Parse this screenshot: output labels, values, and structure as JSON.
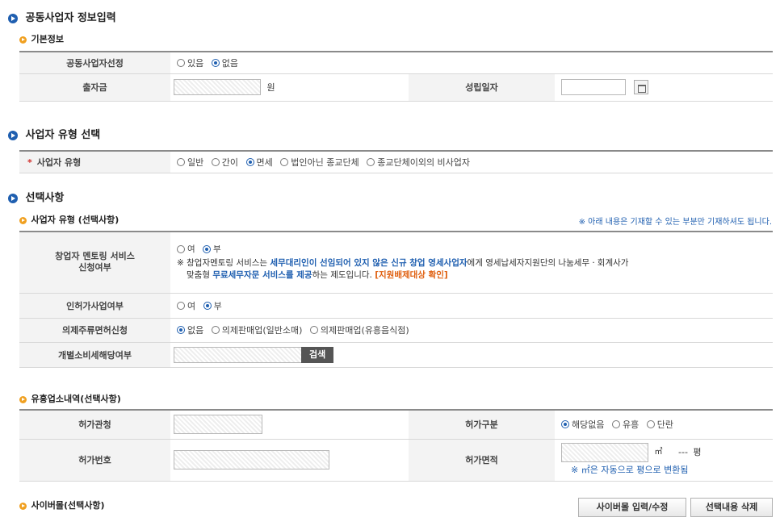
{
  "sections": {
    "joint_title": "공동사업자 정보입력",
    "type_title": "사업자 유형 선택",
    "optional_title": "선택사항"
  },
  "basic": {
    "title": "기본정보",
    "joint_label": "공동사업자선정",
    "joint_options": [
      "있음",
      "없음"
    ],
    "joint_selected": "없음",
    "capital_label": "출자금",
    "capital_unit": "원",
    "founding_label": "성립일자"
  },
  "biz_type": {
    "label": "사업자 유형",
    "required_mark": "*",
    "options": [
      "일반",
      "간이",
      "면세",
      "법인아닌 종교단체",
      "종교단체이외의 비사업자"
    ],
    "selected": "면세"
  },
  "optional": {
    "subtitle": "사업자 유형 (선택사항)",
    "note": "※ 아래 내용은 기재할 수 있는 부분만 기재하셔도 됩니다.",
    "mentoring_label_1": "창업자 멘토링 서비스",
    "mentoring_label_2": "신청여부",
    "yes_no": [
      "여",
      "부"
    ],
    "mentoring_selected": "부",
    "mentoring_desc": {
      "p1": "※ 창업자멘토링 서비스는 ",
      "p2": "세무대리인이 선임되어 있지 않은 신규 창업 영세사업자",
      "p3": "에게 영세납세자지원단의 나눔세무ㆍ회계사가",
      "p4": "맞춤형 ",
      "p5": "무료세무자문 서비스를 제공",
      "p6": "하는 제도입니다. ",
      "p7": "[지원배제대상 확인]"
    },
    "license_label": "인허가사업여부",
    "license_selected": "부",
    "liquor_label": "의제주류면허신청",
    "liquor_options": [
      "없음",
      "의제판매업(일반소매)",
      "의제판매업(유흥음식점)"
    ],
    "liquor_selected": "없음",
    "excise_label": "개별소비세해당여부",
    "search_button": "검색"
  },
  "entertainment": {
    "title": "유흥업소내역(선택사항)",
    "authority_label": "허가관청",
    "category_label": "허가구분",
    "category_options": [
      "해당없음",
      "유흥",
      "단란"
    ],
    "category_selected": "해당없음",
    "number_label": "허가번호",
    "area_label": "허가면적",
    "area_unit": "㎡",
    "pyeong_value": "---",
    "pyeong_unit": "평",
    "area_note": "※ ㎡은 자동으로 평으로 변환됨"
  },
  "cyber": {
    "title": "사이버몰(선택사항)",
    "edit_button": "사이버몰 입력/수정",
    "delete_button": "선택내용 삭제"
  }
}
